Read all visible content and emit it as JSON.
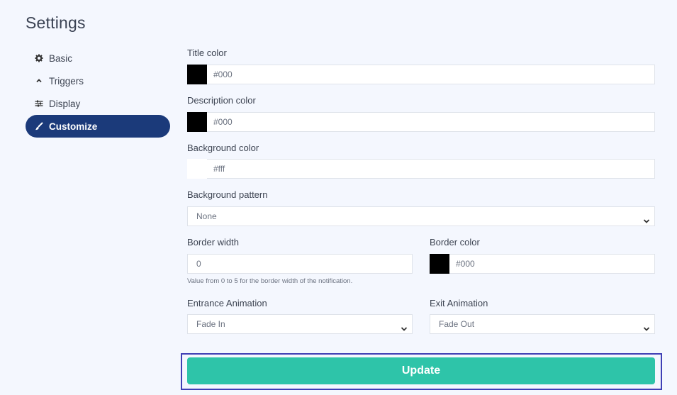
{
  "page": {
    "title": "Settings"
  },
  "sidebar": {
    "items": [
      {
        "label": "Basic",
        "icon": "gear-icon",
        "active": false
      },
      {
        "label": "Triggers",
        "icon": "chevron-up-icon",
        "active": false
      },
      {
        "label": "Display",
        "icon": "sliders-icon",
        "active": false
      },
      {
        "label": "Customize",
        "icon": "paintbrush-icon",
        "active": true
      }
    ]
  },
  "form": {
    "title_color": {
      "label": "Title color",
      "value": "#000",
      "swatch": "#000000"
    },
    "description_color": {
      "label": "Description color",
      "value": "#000",
      "swatch": "#000000"
    },
    "background_color": {
      "label": "Background color",
      "value": "#fff",
      "swatch": "#ffffff"
    },
    "background_pattern": {
      "label": "Background pattern",
      "value": "None"
    },
    "border_width": {
      "label": "Border width",
      "value": "0",
      "help": "Value from 0 to 5 for the border width of the notification."
    },
    "border_color": {
      "label": "Border color",
      "value": "#000",
      "swatch": "#000000"
    },
    "entrance_animation": {
      "label": "Entrance Animation",
      "value": "Fade In"
    },
    "exit_animation": {
      "label": "Exit Animation",
      "value": "Fade Out"
    },
    "update_label": "Update"
  },
  "colors": {
    "accent": "#2ec4a9",
    "active_nav": "#1b3a7a",
    "focus_outline": "#3f3fb5"
  }
}
